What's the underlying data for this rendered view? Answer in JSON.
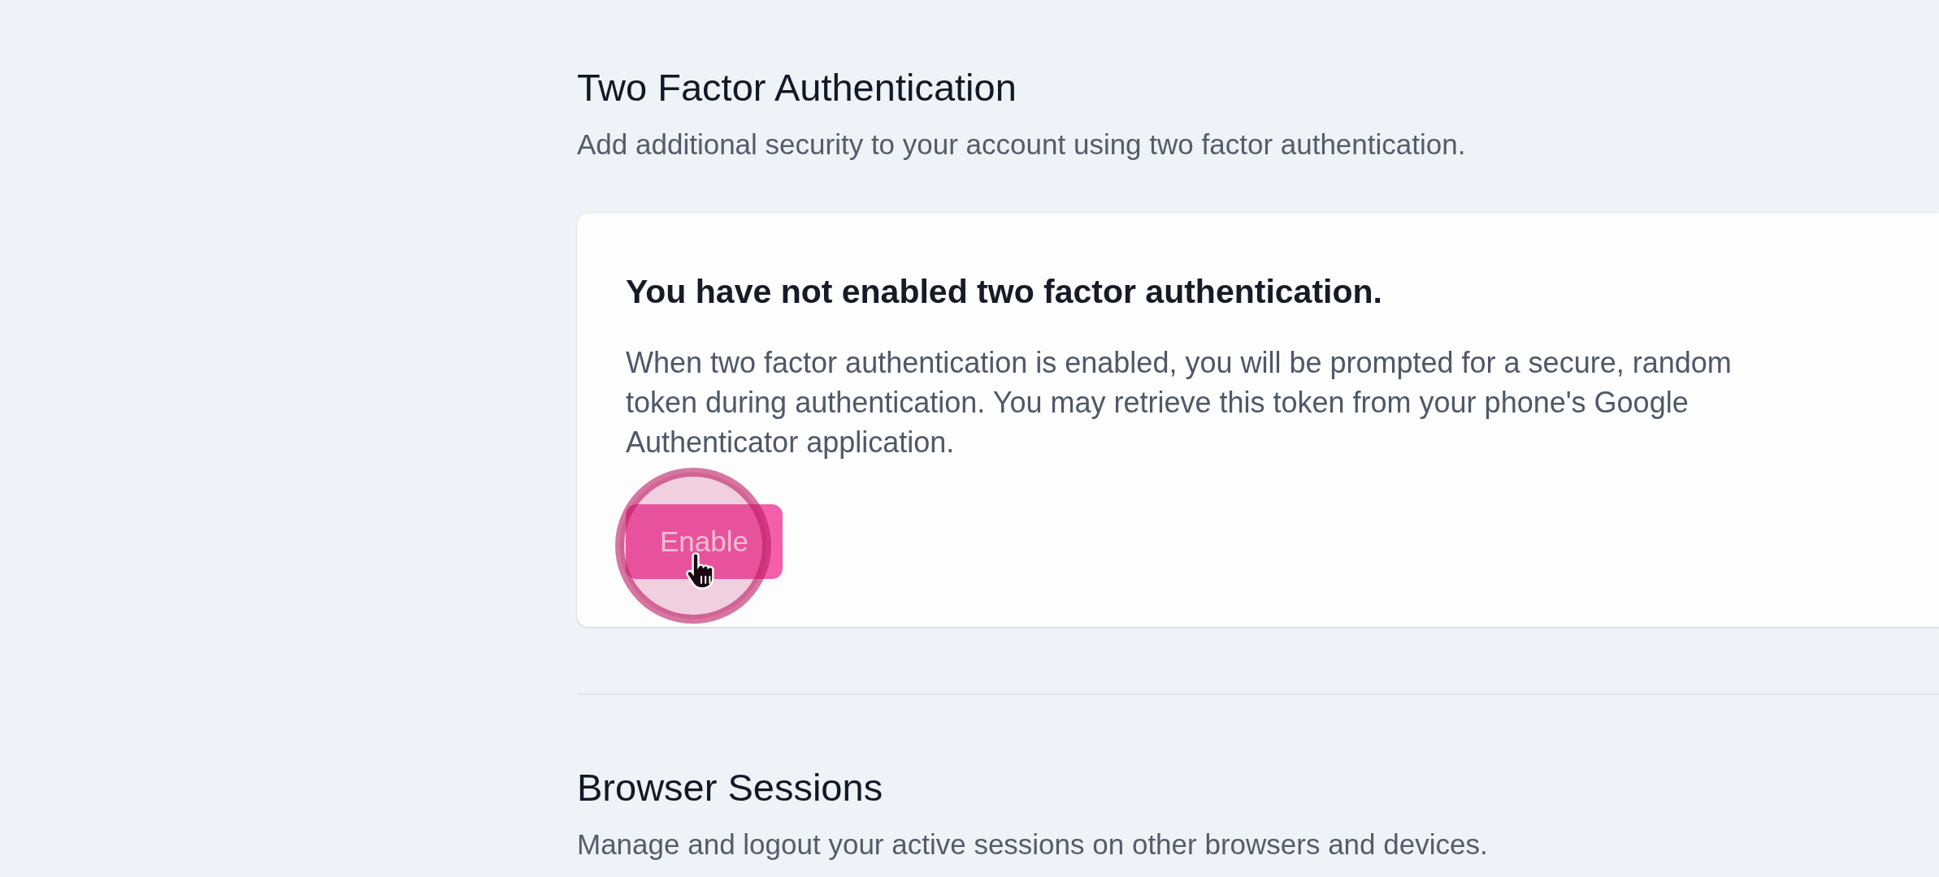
{
  "sections": [
    {
      "title": "Two Factor Authentication",
      "description": "Add additional security to your account using two factor authentication.",
      "card": {
        "heading": "You have not enabled two factor authentication.",
        "body": "When two factor authentication is enabled, you will be prompted for a secure, random token during authentication. You may retrieve this token from your phone's Google Authenticator application.",
        "button": {
          "label": "Enable"
        }
      }
    },
    {
      "title": "Browser Sessions",
      "description": "Manage and logout your active sessions on other browsers and devices."
    }
  ]
}
